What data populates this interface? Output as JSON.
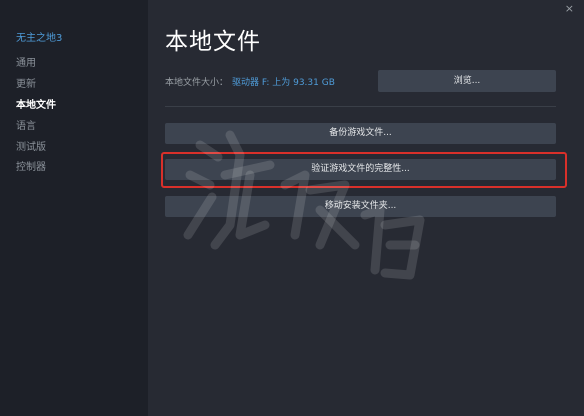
{
  "sidebar": {
    "game_title": "无主之地3",
    "items": [
      {
        "label": "通用"
      },
      {
        "label": "更新"
      },
      {
        "label": "本地文件"
      },
      {
        "label": "语言"
      },
      {
        "label": "测试版"
      },
      {
        "label": "控制器"
      }
    ]
  },
  "main": {
    "title": "本地文件",
    "size_label": "本地文件大小：",
    "size_value": "驱动器 F: 上为 93.31 GB",
    "browse_label": "浏览...",
    "backup_label": "备份游戏文件...",
    "verify_label": "验证游戏文件的完整性...",
    "move_label": "移动安装文件夹..."
  },
  "window": {
    "close_glyph": "×"
  },
  "colors": {
    "accent": "#4f9cd9",
    "highlight": "#d9302a",
    "button": "#3d4450"
  }
}
